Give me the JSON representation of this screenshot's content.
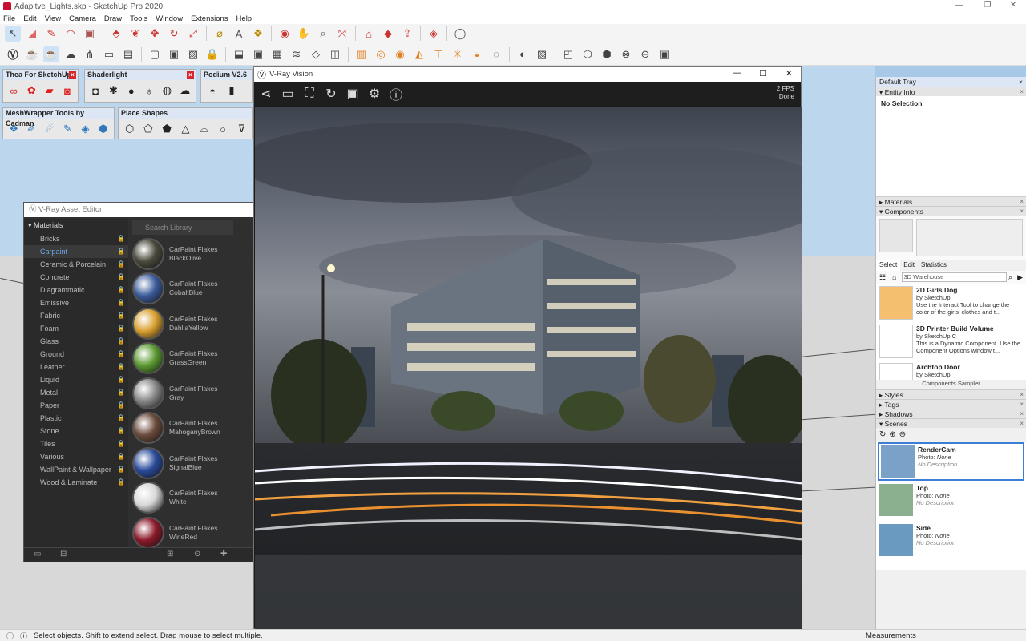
{
  "window": {
    "title": "Adapitve_Lights.skp - SketchUp Pro 2020"
  },
  "menu": [
    "File",
    "Edit",
    "View",
    "Camera",
    "Draw",
    "Tools",
    "Window",
    "Extensions",
    "Help"
  ],
  "panels": {
    "thea": "Thea For SketchUp",
    "shaderlight": "Shaderlight",
    "podium": "Podium V2.6",
    "meshwrapper": "MeshWrapper Tools by Cadman",
    "placeshapes": "Place Shapes"
  },
  "asset_editor": {
    "title": "V-Ray Asset Editor",
    "category_header": "Materials",
    "categories": [
      "Bricks",
      "Carpaint",
      "Ceramic & Porcelain",
      "Concrete",
      "Diagrammatic",
      "Emissive",
      "Fabric",
      "Foam",
      "Glass",
      "Ground",
      "Leather",
      "Liquid",
      "Metal",
      "Paper",
      "Plastic",
      "Stone",
      "Tiles",
      "Various",
      "WallPaint & Wallpaper",
      "Wood & Laminate"
    ],
    "search_placeholder": "Search Library",
    "materials": [
      {
        "name": "CarPaint Flakes BlackOlive",
        "color": "#4a4a3c"
      },
      {
        "name": "CarPaint Flakes CobaltBlue",
        "color": "#3b5b9a"
      },
      {
        "name": "CarPaint Flakes DahliaYellow",
        "color": "#d9a030"
      },
      {
        "name": "CarPaint Flakes GrassGreen",
        "color": "#5a9a30"
      },
      {
        "name": "CarPaint Flakes Gray",
        "color": "#8a8a8a"
      },
      {
        "name": "CarPaint Flakes MahoganyBrown",
        "color": "#6a4a3a"
      },
      {
        "name": "CarPaint Flakes SignalBlue",
        "color": "#2a4a9a"
      },
      {
        "name": "CarPaint Flakes White",
        "color": "#d8d8d8"
      },
      {
        "name": "CarPaint Flakes WineRed",
        "color": "#8a1a2a"
      }
    ]
  },
  "vray": {
    "title": "V-Ray Vision",
    "fps": "2 FPS",
    "state": "Done"
  },
  "tray": {
    "title": "Default Tray",
    "entity_info": "Entity Info",
    "no_selection": "No Selection",
    "materials": "Materials",
    "components": "Components",
    "tabs": [
      "Select",
      "Edit",
      "Statistics"
    ],
    "search": "3D Warehouse",
    "components_list": [
      {
        "name": "2D Girls Dog",
        "by": "by SketchUp",
        "desc": "Use the Interact Tool to change the color of the girls' clothes and t..."
      },
      {
        "name": "3D Printer Build Volume",
        "by": "by SketchUp C",
        "desc": "This is a Dynamic Component. Use the Component Options window t..."
      },
      {
        "name": "Archtop Door",
        "by": "by SketchUp",
        "desc": ""
      }
    ],
    "sampler": "Components Sampler",
    "styles": "Styles",
    "tags": "Tags",
    "shadows": "Shadows",
    "scenes": "Scenes",
    "scene_list": [
      {
        "name": "RenderCam",
        "photo": "None",
        "desc": "No Description"
      },
      {
        "name": "Top",
        "photo": "None",
        "desc": "No Description"
      },
      {
        "name": "Side",
        "photo": "None",
        "desc": "No Description"
      }
    ],
    "photo_label": "Photo: "
  },
  "status": {
    "text": "Select objects. Shift to extend select. Drag mouse to select multiple.",
    "measurements": "Measurements"
  }
}
